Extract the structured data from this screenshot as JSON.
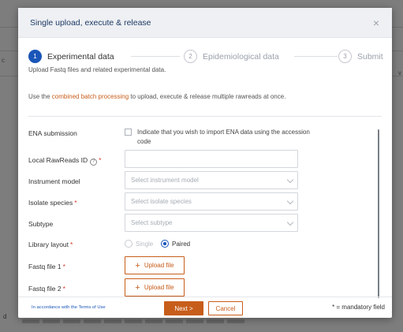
{
  "modal": {
    "title": "Single upload, execute & release",
    "close": "×"
  },
  "stepper": {
    "steps": [
      {
        "number": "1",
        "label": "Experimental data"
      },
      {
        "number": "2",
        "label": "Epidemiological data"
      },
      {
        "number": "3",
        "label": "Submit"
      }
    ]
  },
  "subtitle": "Upload Fastq files and related experimental data.",
  "info": {
    "prefix": "Use the ",
    "link": "combined batch processing",
    "suffix": " to upload, execute & release multiple rawreads at once."
  },
  "form": {
    "ena": {
      "label": "ENA submission",
      "checkbox_text": "Indicate that you wish to import ENA data using the accession code"
    },
    "local_id": {
      "label": "Local RawReads ID",
      "required": "*",
      "help": "?",
      "value": ""
    },
    "instrument": {
      "label": "Instrument model",
      "placeholder": "Select instrument model"
    },
    "species": {
      "label": "Isolate species",
      "required": "*",
      "placeholder": "Select isolate species"
    },
    "subtype": {
      "label": "Subtype",
      "placeholder": "Select subtype"
    },
    "layout": {
      "label": "Library layout",
      "required": "*",
      "options": [
        "Single",
        "Paired"
      ],
      "selected": "Paired"
    },
    "fastq1": {
      "label": "Fastq file 1",
      "required": "*",
      "button": "Upload file"
    },
    "fastq2": {
      "label": "Fastq file 2",
      "required": "*",
      "button": "Upload file"
    }
  },
  "footer": {
    "terms": "In accordance with the Terms of Use",
    "next": "Next >",
    "cancel": "Cancel",
    "mandatory": "* = mandatory field"
  },
  "background": {
    "left_letter_1": "c",
    "left_letter_2": "d",
    "right_letter": "v"
  },
  "colors": {
    "accent": "#c75d1b",
    "primary": "#1a56b8",
    "required": "#d93a2b"
  }
}
